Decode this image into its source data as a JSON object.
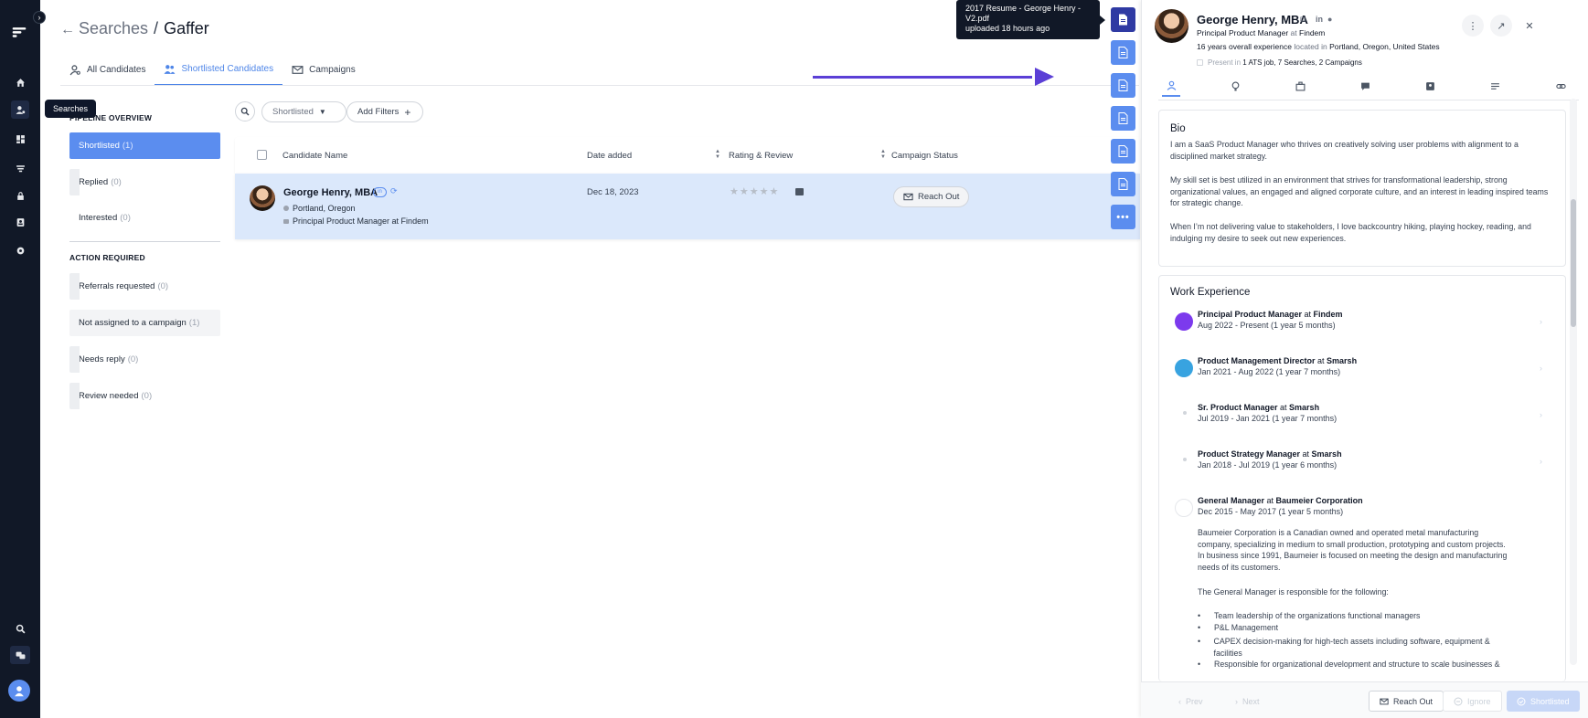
{
  "rail": {
    "icons": [
      "home-icon",
      "searches-icon",
      "dashboard-icon",
      "feed-icon",
      "lock-icon",
      "contacts-icon",
      "settings-icon",
      "search-icon",
      "chat-icon",
      "user-avatar"
    ],
    "tooltip": "Searches"
  },
  "header": {
    "crumb_root": "Searches",
    "crumb_sep": "/",
    "crumb_current": "Gaffer"
  },
  "tabs": [
    {
      "label": "All Candidates"
    },
    {
      "label": "Shortlisted Candidates"
    },
    {
      "label": "Campaigns"
    }
  ],
  "pipeline": {
    "title": "PIPELINE OVERVIEW",
    "items": [
      {
        "label": "Shortlisted",
        "count": "(1)"
      },
      {
        "label": "Replied",
        "count": "(0)"
      },
      {
        "label": "Interested",
        "count": "(0)"
      }
    ]
  },
  "action_required": {
    "title": "ACTION REQUIRED",
    "items": [
      {
        "label": "Referrals requested",
        "count": "(0)"
      },
      {
        "label": "Not assigned to a campaign",
        "count": "(1)"
      },
      {
        "label": "Needs reply",
        "count": "(0)"
      },
      {
        "label": "Review needed",
        "count": "(0)"
      }
    ]
  },
  "filters": {
    "status": "Shortlisted",
    "add_filters": "Add Filters"
  },
  "table": {
    "columns": [
      "Candidate Name",
      "Date added",
      "Rating & Review",
      "Campaign Status"
    ],
    "rows": [
      {
        "name": "George Henry, MBA",
        "location": "Portland, Oregon",
        "position": "Principal Product Manager at Findem",
        "date_added": "Dec 18, 2023",
        "stars": "★★★★★",
        "campaign_action": "Reach Out"
      }
    ]
  },
  "doc_tooltip": {
    "line1": "2017 Resume - George Henry -",
    "line2": "V2.pdf",
    "line3": "uploaded 18 hours ago"
  },
  "profile": {
    "name": "George Henry, MBA",
    "title": "Principal Product Manager",
    "at": "at",
    "company": "Findem",
    "experience": "16 years overall experience",
    "located_in": "located in",
    "location": "Portland, Oregon, United States",
    "present_label": "Present in",
    "present_value": "1 ATS job, 7 Searches, 2 Campaigns"
  },
  "bio": {
    "title": "Bio",
    "p1": "I am a SaaS Product Manager who thrives on creatively solving user problems with alignment to a disciplined market strategy.",
    "p2": "My skill set is best utilized in an environment that strives for transformational leadership, strong organizational values, an engaged and aligned corporate culture, and an interest in leading inspired teams for strategic change.",
    "p3": "When I’m not delivering value to stakeholders, I love backcountry hiking, playing hockey, reading, and indulging my desire to seek out new experiences."
  },
  "work": {
    "title": "Work Experience",
    "jobs": [
      {
        "role": "Principal Product Manager",
        "company": "Findem",
        "dates": "Aug 2022 - Present (1 year 5 months)"
      },
      {
        "role": "Product Management Director",
        "company": "Smarsh",
        "dates": "Jan 2021 - Aug 2022 (1 year 7 months)"
      },
      {
        "role": "Sr. Product Manager",
        "company": "Smarsh",
        "dates": "Jul 2019 - Jan 2021 (1 year 7 months)"
      },
      {
        "role": "Product Strategy Manager",
        "company": "Smarsh",
        "dates": "Jan 2018 - Jul 2019 (1 year 6 months)"
      },
      {
        "role": "General Manager",
        "company": "Baumeier Corporation",
        "dates": "Dec 2015 - May 2017 (1 year 5 months)"
      }
    ],
    "gm_desc": "Baumeier Corporation is a Canadian owned and operated metal manufacturing company, specializing in medium to small production, prototyping and custom projects. In business since 1991, Baumeier is focused on meeting the design and manufacturing needs of its customers.",
    "gm_resp": "The General Manager is responsible for the following:",
    "bullets": [
      "Team leadership of the organizations functional managers",
      "P&L Management",
      "CAPEX decision-making for high-tech assets including software, equipment & facilities",
      "Responsible for organizational development and structure to scale businesses &"
    ]
  },
  "footer": {
    "prev": "Prev",
    "next": "Next",
    "reach": "Reach Out",
    "ignore": "Ignore",
    "shortlisted": "Shortlisted"
  }
}
